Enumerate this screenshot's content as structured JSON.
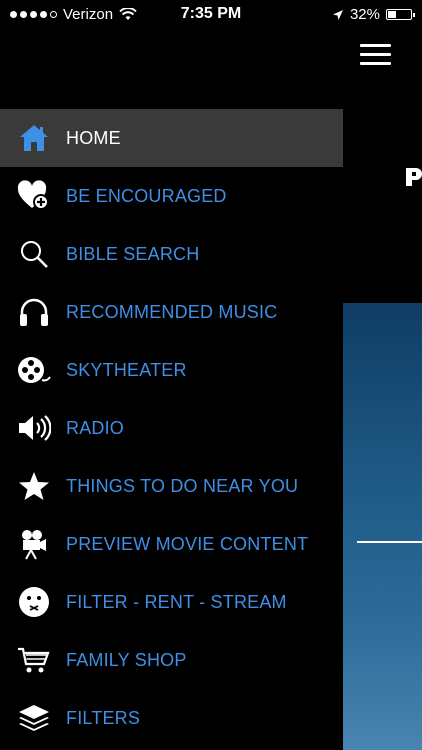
{
  "status_bar": {
    "carrier": "Verizon",
    "time": "7:35 PM",
    "battery_percent_text": "32%",
    "battery_level": 0.32
  },
  "menu": {
    "items": [
      {
        "label": "HOME",
        "icon": "home-icon",
        "active": true
      },
      {
        "label": "BE ENCOURAGED",
        "icon": "heart-plus-icon"
      },
      {
        "label": "BIBLE SEARCH",
        "icon": "search-icon"
      },
      {
        "label": "RECOMMENDED MUSIC",
        "icon": "headphones-icon"
      },
      {
        "label": "SKYTHEATER",
        "icon": "film-reel-icon"
      },
      {
        "label": "RADIO",
        "icon": "speaker-icon"
      },
      {
        "label": "THINGS TO DO NEAR YOU",
        "icon": "star-icon"
      },
      {
        "label": "PREVIEW MOVIE CONTENT",
        "icon": "movie-camera-icon"
      },
      {
        "label": "FILTER - RENT - STREAM",
        "icon": "face-icon"
      },
      {
        "label": "FAMILY SHOP",
        "icon": "cart-icon"
      },
      {
        "label": "FILTERS",
        "icon": "layers-icon"
      }
    ]
  },
  "colors": {
    "accent": "#3f8fe6",
    "active_bg": "#3a3a3a",
    "background": "#000000"
  }
}
